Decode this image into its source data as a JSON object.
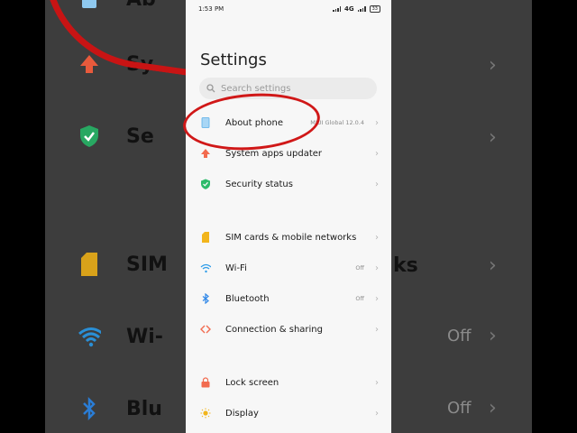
{
  "status_bar": {
    "time": "1:53 PM",
    "network": "4G",
    "battery": "33"
  },
  "page": {
    "title": "Settings"
  },
  "search": {
    "placeholder": "Search settings"
  },
  "settings_groups": [
    [
      {
        "id": "about-phone",
        "label": "About phone",
        "value": "MIUI Global 12.0.4",
        "icon": "phone-icon",
        "icon_color": "#5aaee8"
      },
      {
        "id": "system-apps-updater",
        "label": "System apps updater",
        "value": "",
        "icon": "up-arrow-icon",
        "icon_color": "#f26b4f"
      },
      {
        "id": "security-status",
        "label": "Security status",
        "value": "",
        "icon": "shield-check-icon",
        "icon_color": "#2dbb6a"
      }
    ],
    [
      {
        "id": "sim-cards",
        "label": "SIM cards & mobile networks",
        "value": "",
        "icon": "sim-card-icon",
        "icon_color": "#f2b51c"
      },
      {
        "id": "wifi",
        "label": "Wi-Fi",
        "value": "Off",
        "icon": "wifi-icon",
        "icon_color": "#2f9ce8"
      },
      {
        "id": "bluetooth",
        "label": "Bluetooth",
        "value": "Off",
        "icon": "bluetooth-icon",
        "icon_color": "#2f87e8"
      },
      {
        "id": "connection-sharing",
        "label": "Connection & sharing",
        "value": "",
        "icon": "connection-icon",
        "icon_color": "#f26b4f"
      }
    ],
    [
      {
        "id": "lock-screen",
        "label": "Lock screen",
        "value": "",
        "icon": "lock-icon",
        "icon_color": "#f26b4f"
      },
      {
        "id": "display",
        "label": "Display",
        "value": "",
        "icon": "sun-icon",
        "icon_color": "#f2b51c"
      }
    ]
  ],
  "background_left": [
    {
      "text": "Ab"
    },
    {
      "text": "Sy"
    },
    {
      "text": "Se"
    },
    {
      "text": "SIM"
    },
    {
      "text": "Wi-"
    },
    {
      "text": "Blu"
    }
  ],
  "background_right": [
    {
      "text": "",
      "value": ""
    },
    {
      "text": "",
      "value": ""
    },
    {
      "text": "",
      "value": ""
    },
    {
      "text": "ks",
      "value": ""
    },
    {
      "text": "",
      "value": "Off"
    },
    {
      "text": "",
      "value": "Off"
    }
  ],
  "annotation_color": "#d01818"
}
